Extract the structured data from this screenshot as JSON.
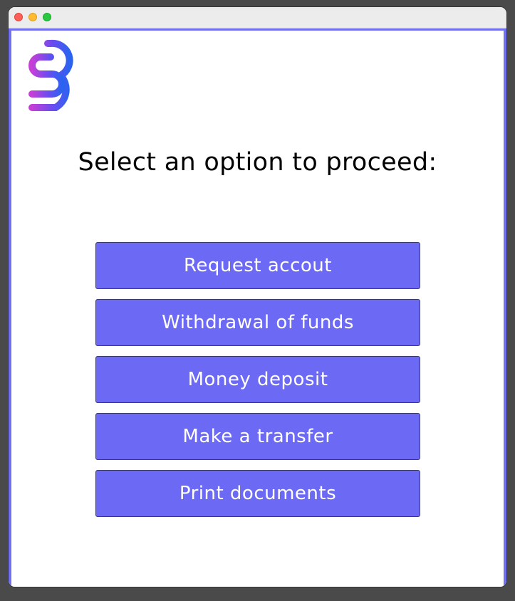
{
  "window": {
    "controls": [
      "close",
      "minimize",
      "maximize"
    ]
  },
  "logo": {
    "icon": "bank-logo-icon",
    "colors": [
      "#c53fd6",
      "#6a4cf0",
      "#2a63f0"
    ]
  },
  "heading": "Select an option to proceed:",
  "menu": {
    "items": [
      {
        "label": "Request accout"
      },
      {
        "label": "Withdrawal of funds"
      },
      {
        "label": "Money deposit"
      },
      {
        "label": "Make a transfer"
      },
      {
        "label": "Print documents"
      }
    ]
  },
  "colors": {
    "accent": "#6c6af4",
    "frame": "#7371f0",
    "background": "#ffffff"
  }
}
